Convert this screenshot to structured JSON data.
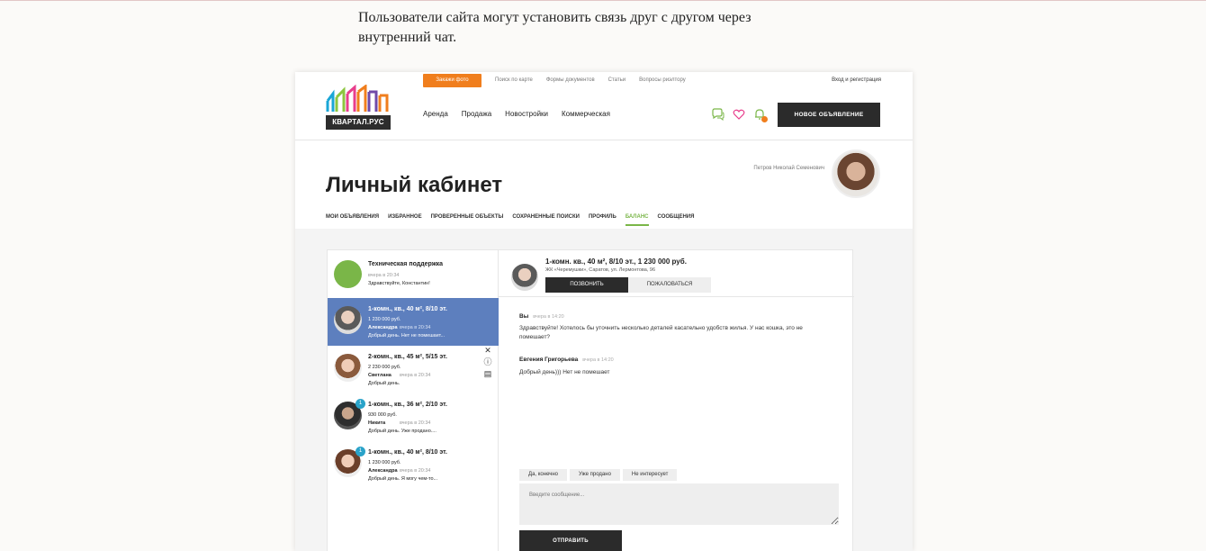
{
  "intro_text": "Пользователи сайта могут установить связь друг с другом через внутренний чат.",
  "header": {
    "logo_text": "КВАРТАЛ.РУС",
    "order_photo": "Закажи фото",
    "top_links": [
      "Поиск по карте",
      "Формы документов",
      "Статьи",
      "Вопросы риэлтору"
    ],
    "login": "Вход и регистрация",
    "main_nav": [
      "Аренда",
      "Продажа",
      "Новостройки",
      "Коммерческая"
    ],
    "icons": [
      "chat-icon",
      "heart-icon",
      "bell-icon"
    ],
    "new_ad_button": "НОВОЕ ОБЪЯВЛЕНИЕ",
    "accent_color": "#f07e1d"
  },
  "cabinet": {
    "title": "Личный кабинет",
    "user_name": "Петров Николай Семенович",
    "tabs": [
      {
        "label": "МОИ ОБЪЯВЛЕНИЯ",
        "active": false
      },
      {
        "label": "ИЗБРАННОЕ",
        "active": false
      },
      {
        "label": "ПРОВЕРЕННЫЕ ОБЪЕКТЫ",
        "active": false
      },
      {
        "label": "СОХРАНЕННЫЕ ПОИСКИ",
        "active": false
      },
      {
        "label": "ПРОФИЛЬ",
        "active": false
      },
      {
        "label": "БАЛАНС",
        "active": true
      },
      {
        "label": "СООБЩЕНИЯ",
        "active": false
      }
    ],
    "active_tab_color": "#7ab648"
  },
  "conversations": [
    {
      "title": "Техническая поддержка",
      "price": "",
      "author": "",
      "time": "вчера в 20:34",
      "message": "Здравствуйте, Константин!",
      "badge": ""
    },
    {
      "title": "1-комн., кв., 40 м², 8/10 эт.",
      "price": "1 230 000 руб.",
      "author": "Александра",
      "time": "вчера в 20:34",
      "message": "Добрый день. Нет не помешает...",
      "badge": ""
    },
    {
      "title": "2-комн., кв., 45 м², 5/15 эт.",
      "price": "2 230 000 руб.",
      "author": "Светлана",
      "time": "вчера в 20:34",
      "message": "Добрый день.",
      "badge": ""
    },
    {
      "title": "1-комн., кв., 36 м², 2/10 эт.",
      "price": "930 000 руб.",
      "author": "Никита",
      "time": "вчера в 20:34",
      "message": "Добрый день. Уже продано....",
      "badge": "1"
    },
    {
      "title": "1-комн., кв., 40 м², 8/10 эт.",
      "price": "1 230 000 руб.",
      "author": "Александра",
      "time": "вчера в 20:34",
      "message": "Добрый день. Я могу чем-то...",
      "badge": "1"
    }
  ],
  "conversation_actions": [
    "close-icon",
    "info-icon",
    "archive-icon"
  ],
  "chat": {
    "title": "1-комн. кв., 40 м², 8/10 эт., 1 230 000 руб.",
    "address": "ЖК «Черемушки», Саратов, ул. Лермонтова, 96",
    "call_button": "ПОЗВОНИТЬ",
    "report_button": "ПОЖАЛОВАТЬСЯ",
    "messages": [
      {
        "author": "Вы",
        "time": "вчера в 14:20",
        "text": "Здравствуйте! Хотелось бы уточнить несколько деталей касательно удобств жилья. У нас кошка, это не помешает?"
      },
      {
        "author": "Евгения Григорьева",
        "time": "вчера в 14:20",
        "text": "Добрый день))) Нет не помешает"
      }
    ],
    "quick_replies": [
      "Да, конечно",
      "Уже продано",
      "Не интересует"
    ],
    "input_placeholder": "Введите сообщение...",
    "send_button": "ОТПРАВИТЬ",
    "active_conversation_color": "#5d7fbe"
  }
}
